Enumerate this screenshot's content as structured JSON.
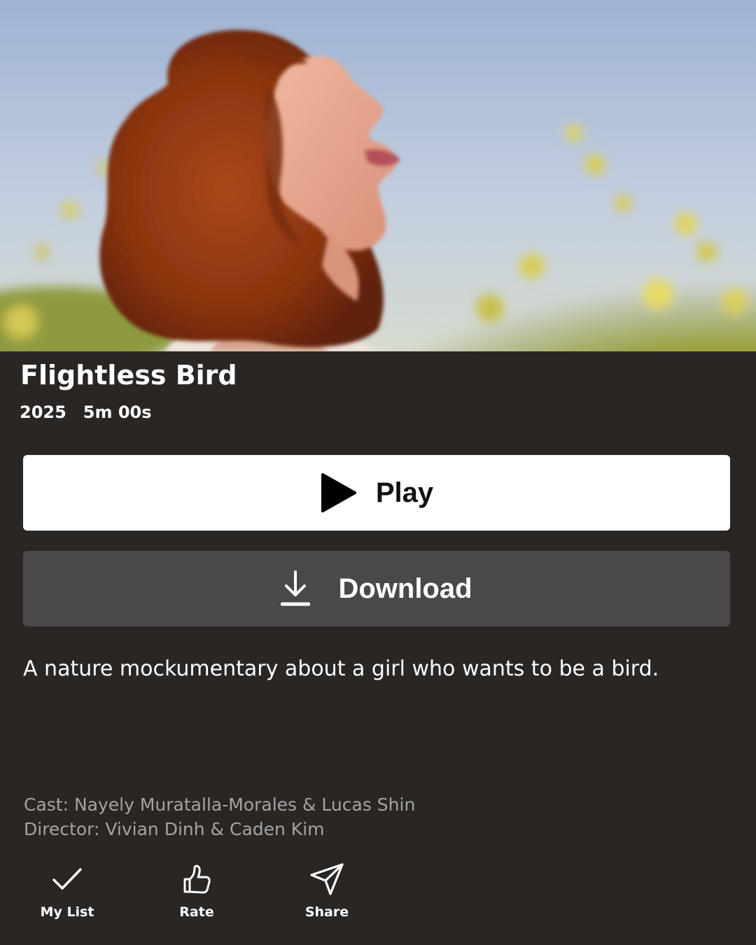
{
  "hero": {
    "image": "woman-in-flower-field-photo"
  },
  "title": "Flightless Bird",
  "meta": {
    "year": "2025",
    "duration": "5m 00s"
  },
  "buttons": {
    "play_label": "Play",
    "play_icon": "play-icon",
    "download_label": "Download",
    "download_icon": "download-icon"
  },
  "description": "A nature mockumentary about a girl who wants to be a bird.",
  "credits": {
    "cast": "Cast: Nayely Muratalla-Morales & Lucas Shin",
    "director": "Director: Vivian Dinh & Caden Kim"
  },
  "actions": [
    {
      "label": "My List",
      "icon": "check-icon"
    },
    {
      "label": "Rate",
      "icon": "thumbs-up-icon"
    },
    {
      "label": "Share",
      "icon": "send-icon"
    }
  ],
  "colors": {
    "background": "#292624",
    "play_button": "#ffffff",
    "download_button": "#4a4848",
    "credits_text": "#a6a4a2"
  }
}
